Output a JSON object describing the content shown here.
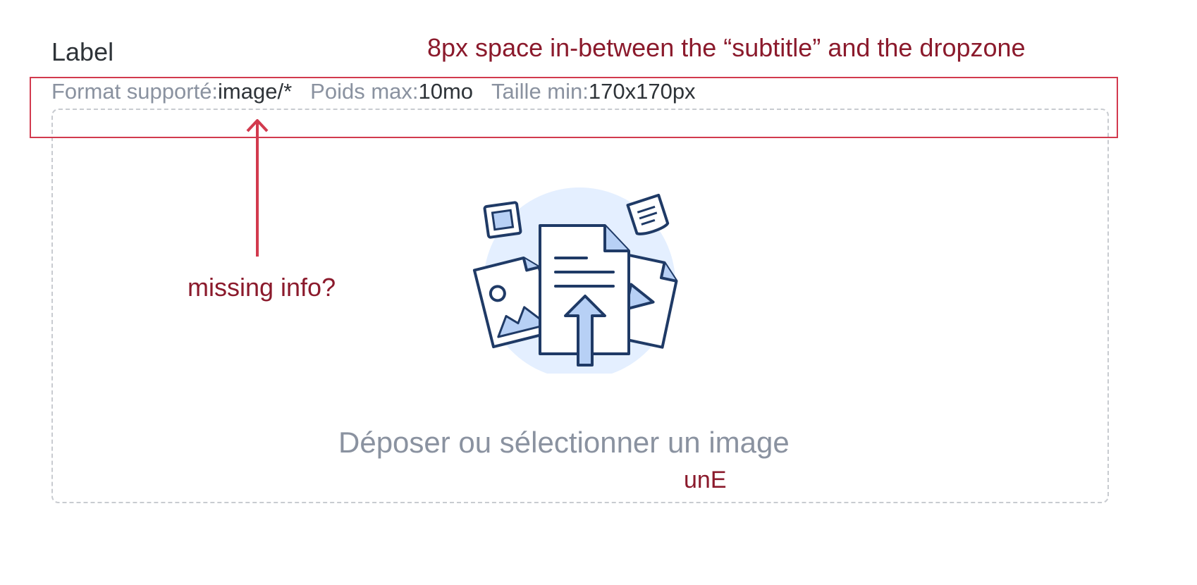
{
  "field": {
    "label": "Label",
    "subtitle": {
      "format_key": "Format supporté:",
      "format_value": "image/*",
      "weight_key": "Poids max:",
      "weight_value": "10mo",
      "size_key": "Taille min:",
      "size_value": "170x170px"
    }
  },
  "dropzone": {
    "text": "Déposer ou sélectionner un image",
    "illustration_icon": "upload-files-illustration"
  },
  "annotations": {
    "spacing_note": "8px space in-between the “subtitle” and the dropzone",
    "missing_info_note": "missing info?",
    "typo_note": "unE",
    "color": "#d23a4e",
    "text_color": "#8b1a2c"
  }
}
